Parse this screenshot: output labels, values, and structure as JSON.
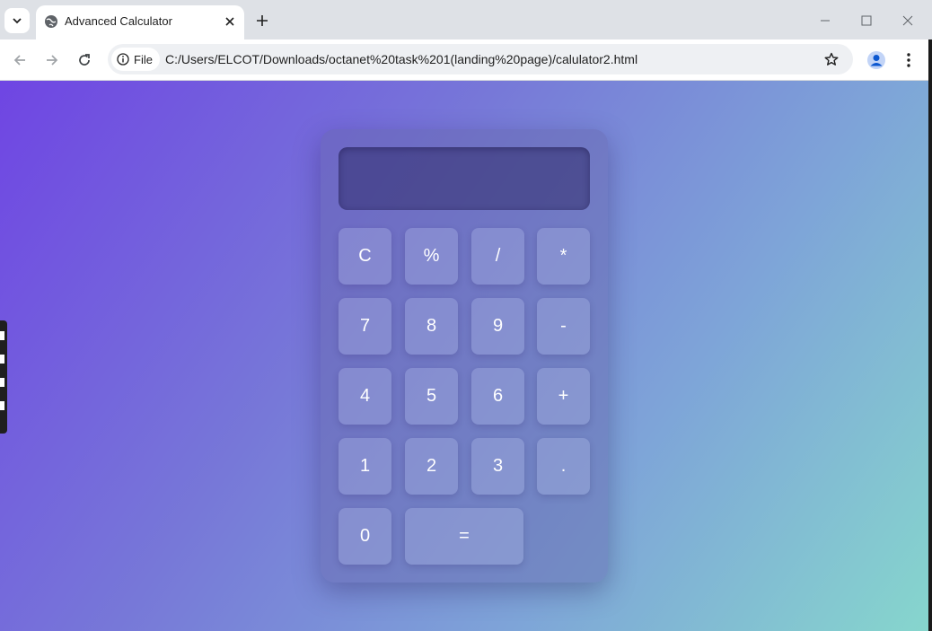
{
  "browser": {
    "tab_title": "Advanced Calculator",
    "file_chip_label": "File",
    "url": "C:/Users/ELCOT/Downloads/octanet%20task%201(landing%20page)/calulator2.html"
  },
  "calculator": {
    "display_value": "",
    "rows": [
      [
        "C",
        "%",
        "/",
        "*"
      ],
      [
        "7",
        "8",
        "9",
        "-"
      ],
      [
        "4",
        "5",
        "6",
        "+"
      ],
      [
        "1",
        "2",
        "3",
        "."
      ],
      [
        "0",
        "="
      ]
    ]
  },
  "colors": {
    "gradient_start": "#6f45e3",
    "gradient_end": "#86d6cd",
    "button_text": "#ffffff"
  }
}
